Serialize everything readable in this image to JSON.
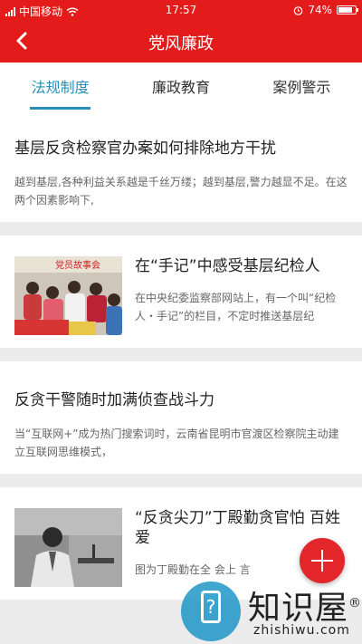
{
  "status_bar": {
    "carrier": "中国移动",
    "time": "17:57",
    "battery": "74%",
    "icons": [
      "signal-icon",
      "wifi-icon",
      "alarm-icon",
      "battery-icon"
    ]
  },
  "header": {
    "title": "党风廉政",
    "back_icon": "chevron-left-icon",
    "accent_color": "#e31b1b"
  },
  "tabs": [
    {
      "label": "法规制度",
      "active": true
    },
    {
      "label": "廉政教育",
      "active": false
    },
    {
      "label": "案例警示",
      "active": false
    }
  ],
  "tab_active_color": "#2a8fb8",
  "articles": [
    {
      "title": "基层反贪检察官办案如何排除地方干扰",
      "summary": "越到基层,各种利益关系越是千丝万缕；越到基层,警力越显不足。在这两个因素影响下,"
    },
    {
      "title": "在“手记”中感受基层纪检人",
      "summary": "在中央纪委监察部网站上，有一个叫“纪检人・手记”的栏目，不定时推送基层纪",
      "thumb_banner": "党员故事会"
    },
    {
      "title": "反贪干警随时加满侦查战斗力",
      "summary": "当“互联网+”成为热门搜索词时，云南省昆明市官渡区检察院主动建立互联网思维模式，"
    },
    {
      "title": "“反贪尖刀”丁殿勤贪官怕 百姓爱",
      "summary": "图为丁殿勤在全 会上 言"
    }
  ],
  "fab": {
    "icon": "plus-icon",
    "color": "#e3262a"
  },
  "watermark": {
    "brand": "知识屋",
    "domain": "zhishiwu.com",
    "mark": "®"
  }
}
